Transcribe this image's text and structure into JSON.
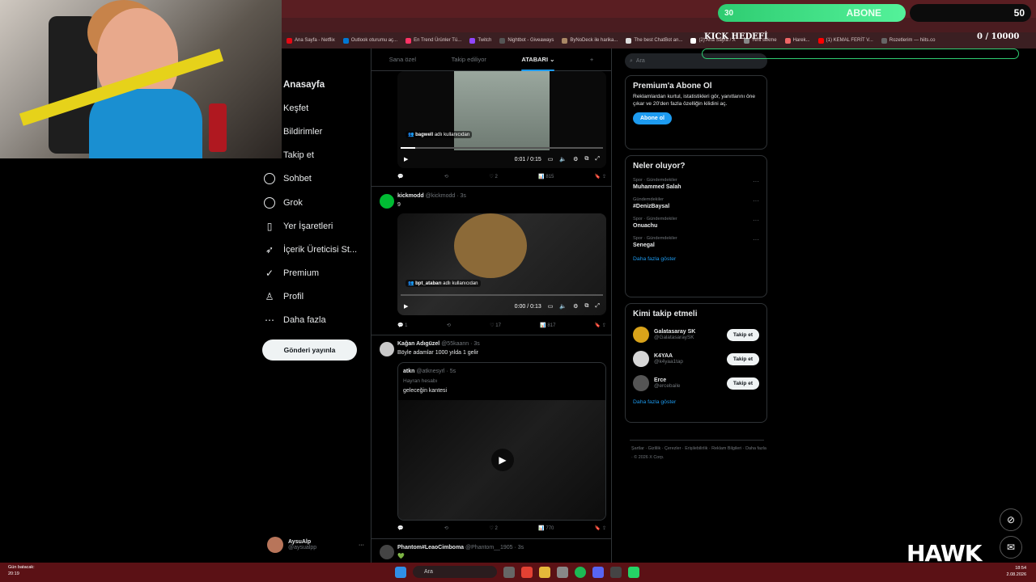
{
  "bookmarks": [
    "Ana Sayfa - Netflix",
    "Outlook oturumu aç...",
    "En Trend Ürünler Tü...",
    "Twitch",
    "Nightbot - Giveaways",
    "ByNoDeck ile harika...",
    "The best ChatBot an...",
    "(2) Ana Sayfa / X",
    "Yeni sekme",
    "Harek...",
    "(1) KEMAL FERİT V...",
    "Rozetlerim — hiits.co"
  ],
  "nav": {
    "items": [
      {
        "label": "Anasayfa",
        "icon": "home-icon"
      },
      {
        "label": "Keşfet",
        "icon": "search-icon"
      },
      {
        "label": "Bildirimler",
        "icon": "bell-icon"
      },
      {
        "label": "Takip et",
        "icon": "follow-icon"
      },
      {
        "label": "Sohbet",
        "icon": "chat-icon"
      },
      {
        "label": "Grok",
        "icon": "grok-icon"
      },
      {
        "label": "Yer İşaretleri",
        "icon": "bookmark-icon"
      },
      {
        "label": "İçerik Üreticisi St...",
        "icon": "rocket-icon"
      },
      {
        "label": "Premium",
        "icon": "verified-icon"
      },
      {
        "label": "Profil",
        "icon": "person-icon"
      },
      {
        "label": "Daha fazla",
        "icon": "more-icon"
      }
    ],
    "post_button": "Gönderi yayınla",
    "account_name": "AysuAlp",
    "account_handle": "@aysualpp"
  },
  "feed": {
    "tabs": [
      "Sana özel",
      "Takip ediliyor",
      "ATABARI"
    ],
    "post1": {
      "tag_user": "bagwell",
      "tag_suffix": "adlı kullanıcıdan",
      "time": "0:01 / 0:15",
      "progress": 0.07,
      "likes": "2",
      "views": "815"
    },
    "post2": {
      "name": "kickmodd",
      "handle": "@kickmodd · 3s",
      "text": "9",
      "tag_user": "bpt_atabarı",
      "tag_suffix": "adlı kullanıcıdan",
      "time": "0:00 / 0:13",
      "progress": 0.0,
      "replies": "1",
      "likes": "17",
      "views": "817"
    },
    "post3": {
      "name": "Kağan Adıgüzel",
      "handle": "@55kaann · 3s",
      "text": "Böyle adamlar 1000 yılda 1 gelir",
      "quote_name": "atkn",
      "quote_handle": "@atknesyrl · 5s",
      "quote_note": "Hayran hesabı",
      "quote_text": "geleceğin kantesi",
      "likes": "2",
      "views": "770"
    },
    "post4": {
      "name": "Phantom#LeaoCimboma",
      "handle": "@Phantom__1905 · 3s",
      "text": "💚"
    }
  },
  "right": {
    "search_placeholder": "Ara",
    "premium": {
      "title": "Premium'a Abone Ol",
      "text": "Reklamlardan kurtul, istatistikleri gör, yanıtlarını öne çıkar ve 20'den fazla özelliğin kilidini aç.",
      "button": "Abone ol"
    },
    "trends": {
      "title": "Neler oluyor?",
      "items": [
        {
          "cat": "Spor · Gündemdekiler",
          "name": "Muhammed Salah"
        },
        {
          "cat": "Gündemdekiler",
          "name": "#DenizBaysal"
        },
        {
          "cat": "Spor · Gündemdekiler",
          "name": "Onuachu"
        },
        {
          "cat": "Spor · Gündemdekiler",
          "name": "Senegal"
        }
      ],
      "more": "Daha fazla göster"
    },
    "follow": {
      "title": "Kimi takip etmeli",
      "items": [
        {
          "name": "Galatasaray SK",
          "handle": "@GalatasaraySK",
          "color": "#d9a31a"
        },
        {
          "name": "K4YAA",
          "handle": "@k4yaa1tap",
          "color": "#d6d6d6"
        },
        {
          "name": "Erce",
          "handle": "@ercebaile",
          "color": "#555555"
        }
      ],
      "button": "Takip et",
      "more": "Daha fazla göster"
    },
    "footer": "Şartlar · Gizlilik · Çerezler · Erişilebilirlik · Reklam Bilgileri · Daha fazla · © 2026 X Corp."
  },
  "overlay": {
    "left_num": "30",
    "label": "ABONE",
    "right_num": "50",
    "kick_title": "KICK HEDEFİ",
    "kick_count": "0 / 10000",
    "hawk": "HAWK"
  },
  "taskbar": {
    "weather_line1": "Gün batacak:",
    "weather_line2": "20:19",
    "search": "Ara",
    "time": "18:54",
    "date": "2.08.2026"
  },
  "colors": {
    "accent": "#1d9bf0",
    "abone_green": "#2ecc71"
  }
}
